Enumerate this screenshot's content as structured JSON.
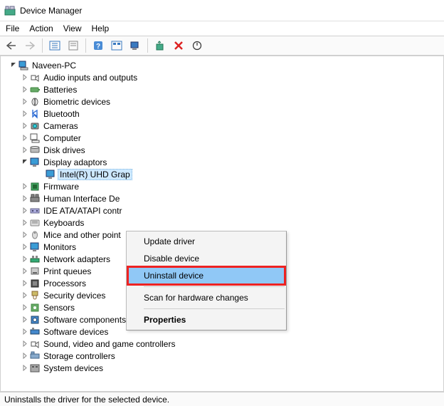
{
  "window": {
    "title": "Device Manager"
  },
  "menu": {
    "file": "File",
    "action": "Action",
    "view": "View",
    "help": "Help"
  },
  "tree": {
    "root": "Naveen-PC",
    "categories": [
      {
        "label": "Audio inputs and outputs",
        "expanded": false
      },
      {
        "label": "Batteries",
        "expanded": false
      },
      {
        "label": "Biometric devices",
        "expanded": false
      },
      {
        "label": "Bluetooth",
        "expanded": false
      },
      {
        "label": "Cameras",
        "expanded": false
      },
      {
        "label": "Computer",
        "expanded": false
      },
      {
        "label": "Disk drives",
        "expanded": false
      },
      {
        "label": "Display adaptors",
        "expanded": true,
        "children": [
          {
            "label": "Intel(R) UHD Grap",
            "selected": true
          }
        ]
      },
      {
        "label": "Firmware",
        "expanded": false
      },
      {
        "label": "Human Interface De",
        "expanded": false
      },
      {
        "label": "IDE ATA/ATAPI contr",
        "expanded": false
      },
      {
        "label": "Keyboards",
        "expanded": false
      },
      {
        "label": "Mice and other point",
        "expanded": false
      },
      {
        "label": "Monitors",
        "expanded": false
      },
      {
        "label": "Network adapters",
        "expanded": false
      },
      {
        "label": "Print queues",
        "expanded": false
      },
      {
        "label": "Processors",
        "expanded": false
      },
      {
        "label": "Security devices",
        "expanded": false
      },
      {
        "label": "Sensors",
        "expanded": false
      },
      {
        "label": "Software components",
        "expanded": false
      },
      {
        "label": "Software devices",
        "expanded": false
      },
      {
        "label": "Sound, video and game controllers",
        "expanded": false
      },
      {
        "label": "Storage controllers",
        "expanded": false
      },
      {
        "label": "System devices",
        "expanded": false
      }
    ]
  },
  "context_menu": {
    "items": [
      {
        "label": "Update driver"
      },
      {
        "label": "Disable device"
      },
      {
        "label": "Uninstall device",
        "highlight": true
      },
      {
        "sep": true
      },
      {
        "label": "Scan for hardware changes"
      },
      {
        "sep": true
      },
      {
        "label": "Properties",
        "bold": true
      }
    ]
  },
  "status": {
    "text": "Uninstalls the driver for the selected device."
  }
}
